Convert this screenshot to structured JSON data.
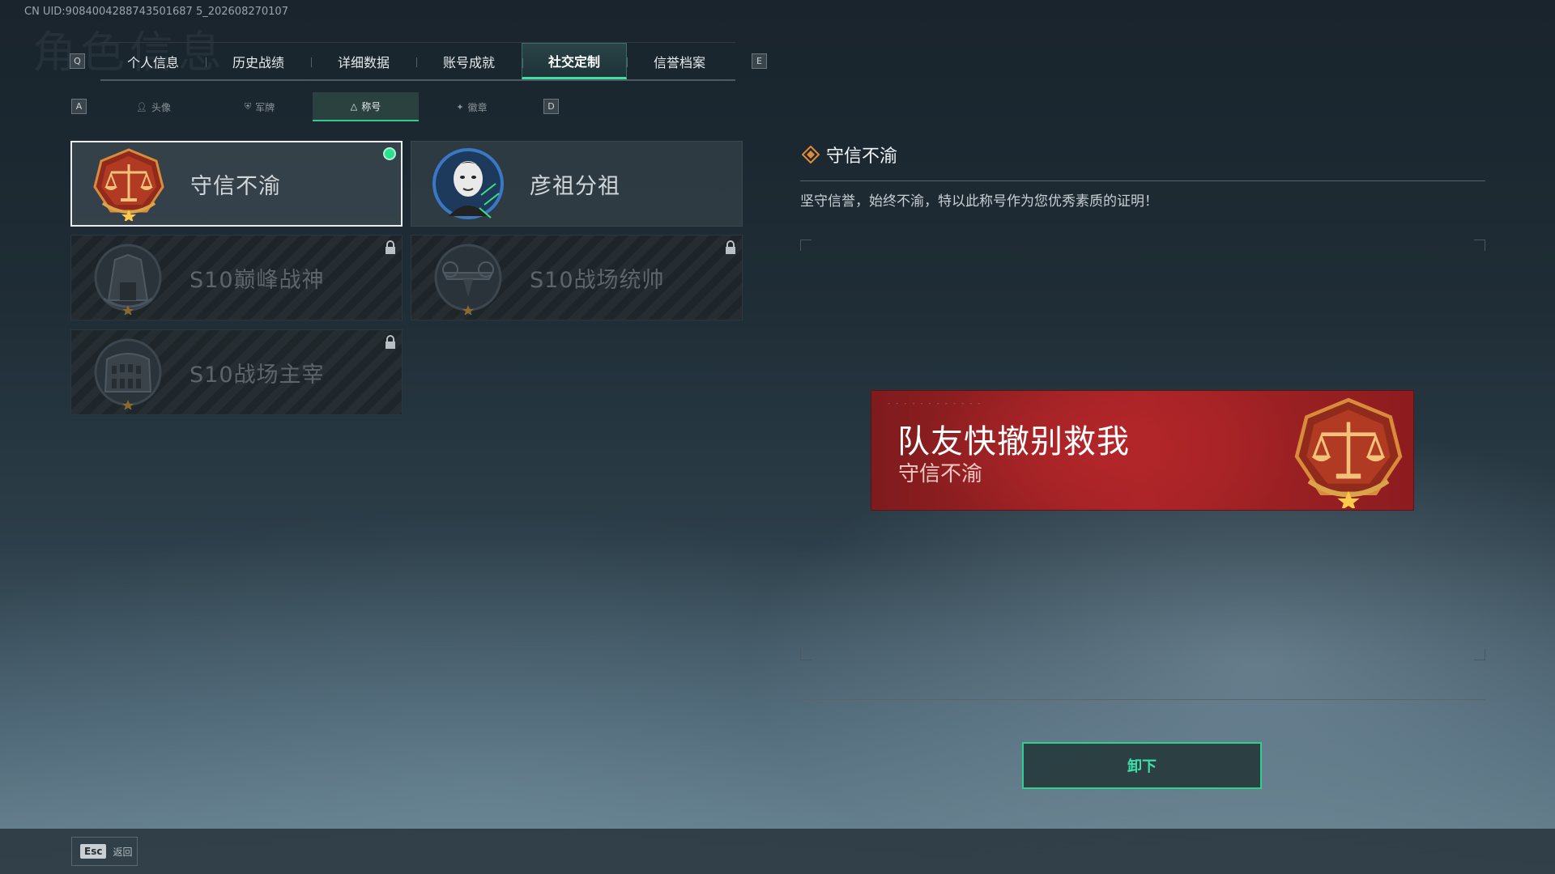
{
  "uid_text": "CN UID:9084004288743501687 5_202608270107",
  "bg_title": "角色信息",
  "tabs": {
    "prev_key": "Q",
    "next_key": "E",
    "items": [
      {
        "label": "个人信息"
      },
      {
        "label": "历史战绩"
      },
      {
        "label": "详细数据"
      },
      {
        "label": "账号成就"
      },
      {
        "label": "社交定制"
      },
      {
        "label": "信誉档案"
      }
    ],
    "active_index": 4
  },
  "subtabs": {
    "prev_key": "A",
    "next_key": "D",
    "items": [
      {
        "label": "头像",
        "icon": "person-icon"
      },
      {
        "label": "军牌",
        "icon": "shield-icon"
      },
      {
        "label": "称号",
        "icon": "triangle-icon"
      },
      {
        "label": "徽章",
        "icon": "wings-icon"
      }
    ],
    "active_index": 2
  },
  "titles": [
    {
      "label": "守信不渝",
      "state": "equipped",
      "emblem": "scales-emblem"
    },
    {
      "label": "彦祖分祖",
      "state": "owned",
      "emblem": "portrait-emblem"
    },
    {
      "label": "S10巅峰战神",
      "state": "locked",
      "emblem": "arch-emblem"
    },
    {
      "label": "S10战场统帅",
      "state": "locked",
      "emblem": "aircraft-emblem"
    },
    {
      "label": "S10战场主宰",
      "state": "locked",
      "emblem": "colosseum-emblem"
    }
  ],
  "detail": {
    "title": "守信不渝",
    "description": "坚守信誉，始终不渝，特以此称号作为您优秀素质的证明！"
  },
  "preview_banner": {
    "nickname": "队友快撤别救我",
    "title": "守信不渝"
  },
  "unequip_label": "卸下",
  "footer": {
    "esc_key": "Esc",
    "back_label": "返回"
  },
  "colors": {
    "accent": "#3ee0a6",
    "banner_red": "#a82426",
    "equipped_dot": "#2de08e"
  }
}
